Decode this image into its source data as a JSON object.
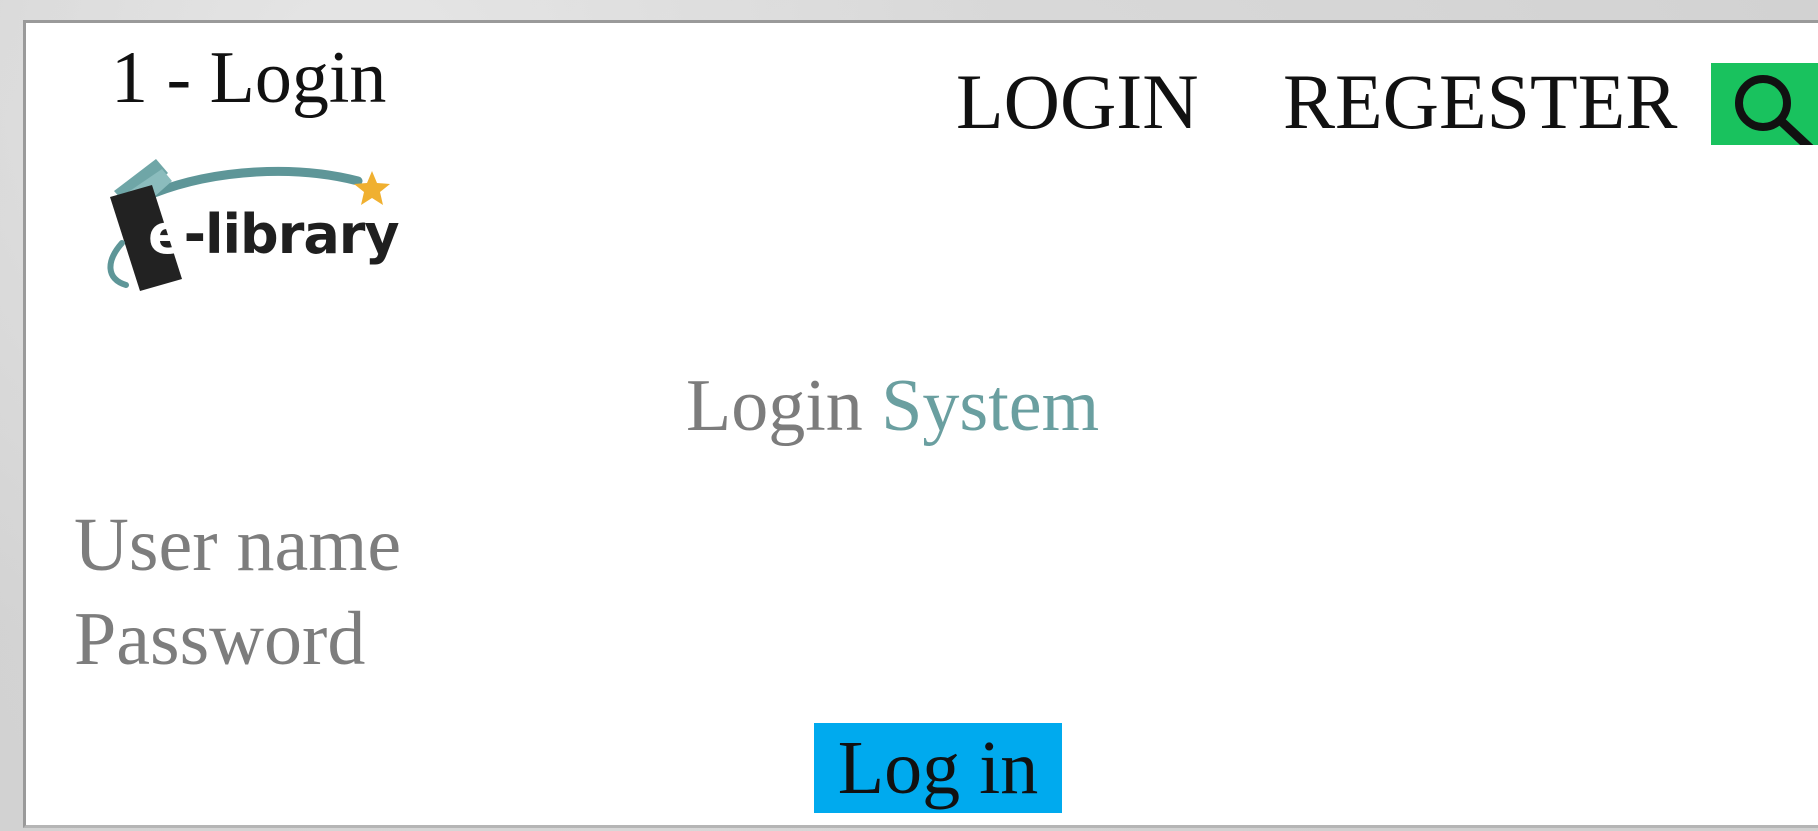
{
  "page": {
    "title": "1 - Login"
  },
  "nav": {
    "login_label": "LOGIN",
    "register_label": "REGESTER",
    "search_icon": "search-icon",
    "search_color": "#19c25e"
  },
  "logo": {
    "text": "e-library",
    "icon": "book-star-logo"
  },
  "form": {
    "title_part1": "Login",
    "title_part2": "System",
    "username_label": "User name",
    "username_value": "",
    "password_label": "Password",
    "password_value": "",
    "submit_label": "Log in",
    "submit_color": "#00aaee"
  }
}
